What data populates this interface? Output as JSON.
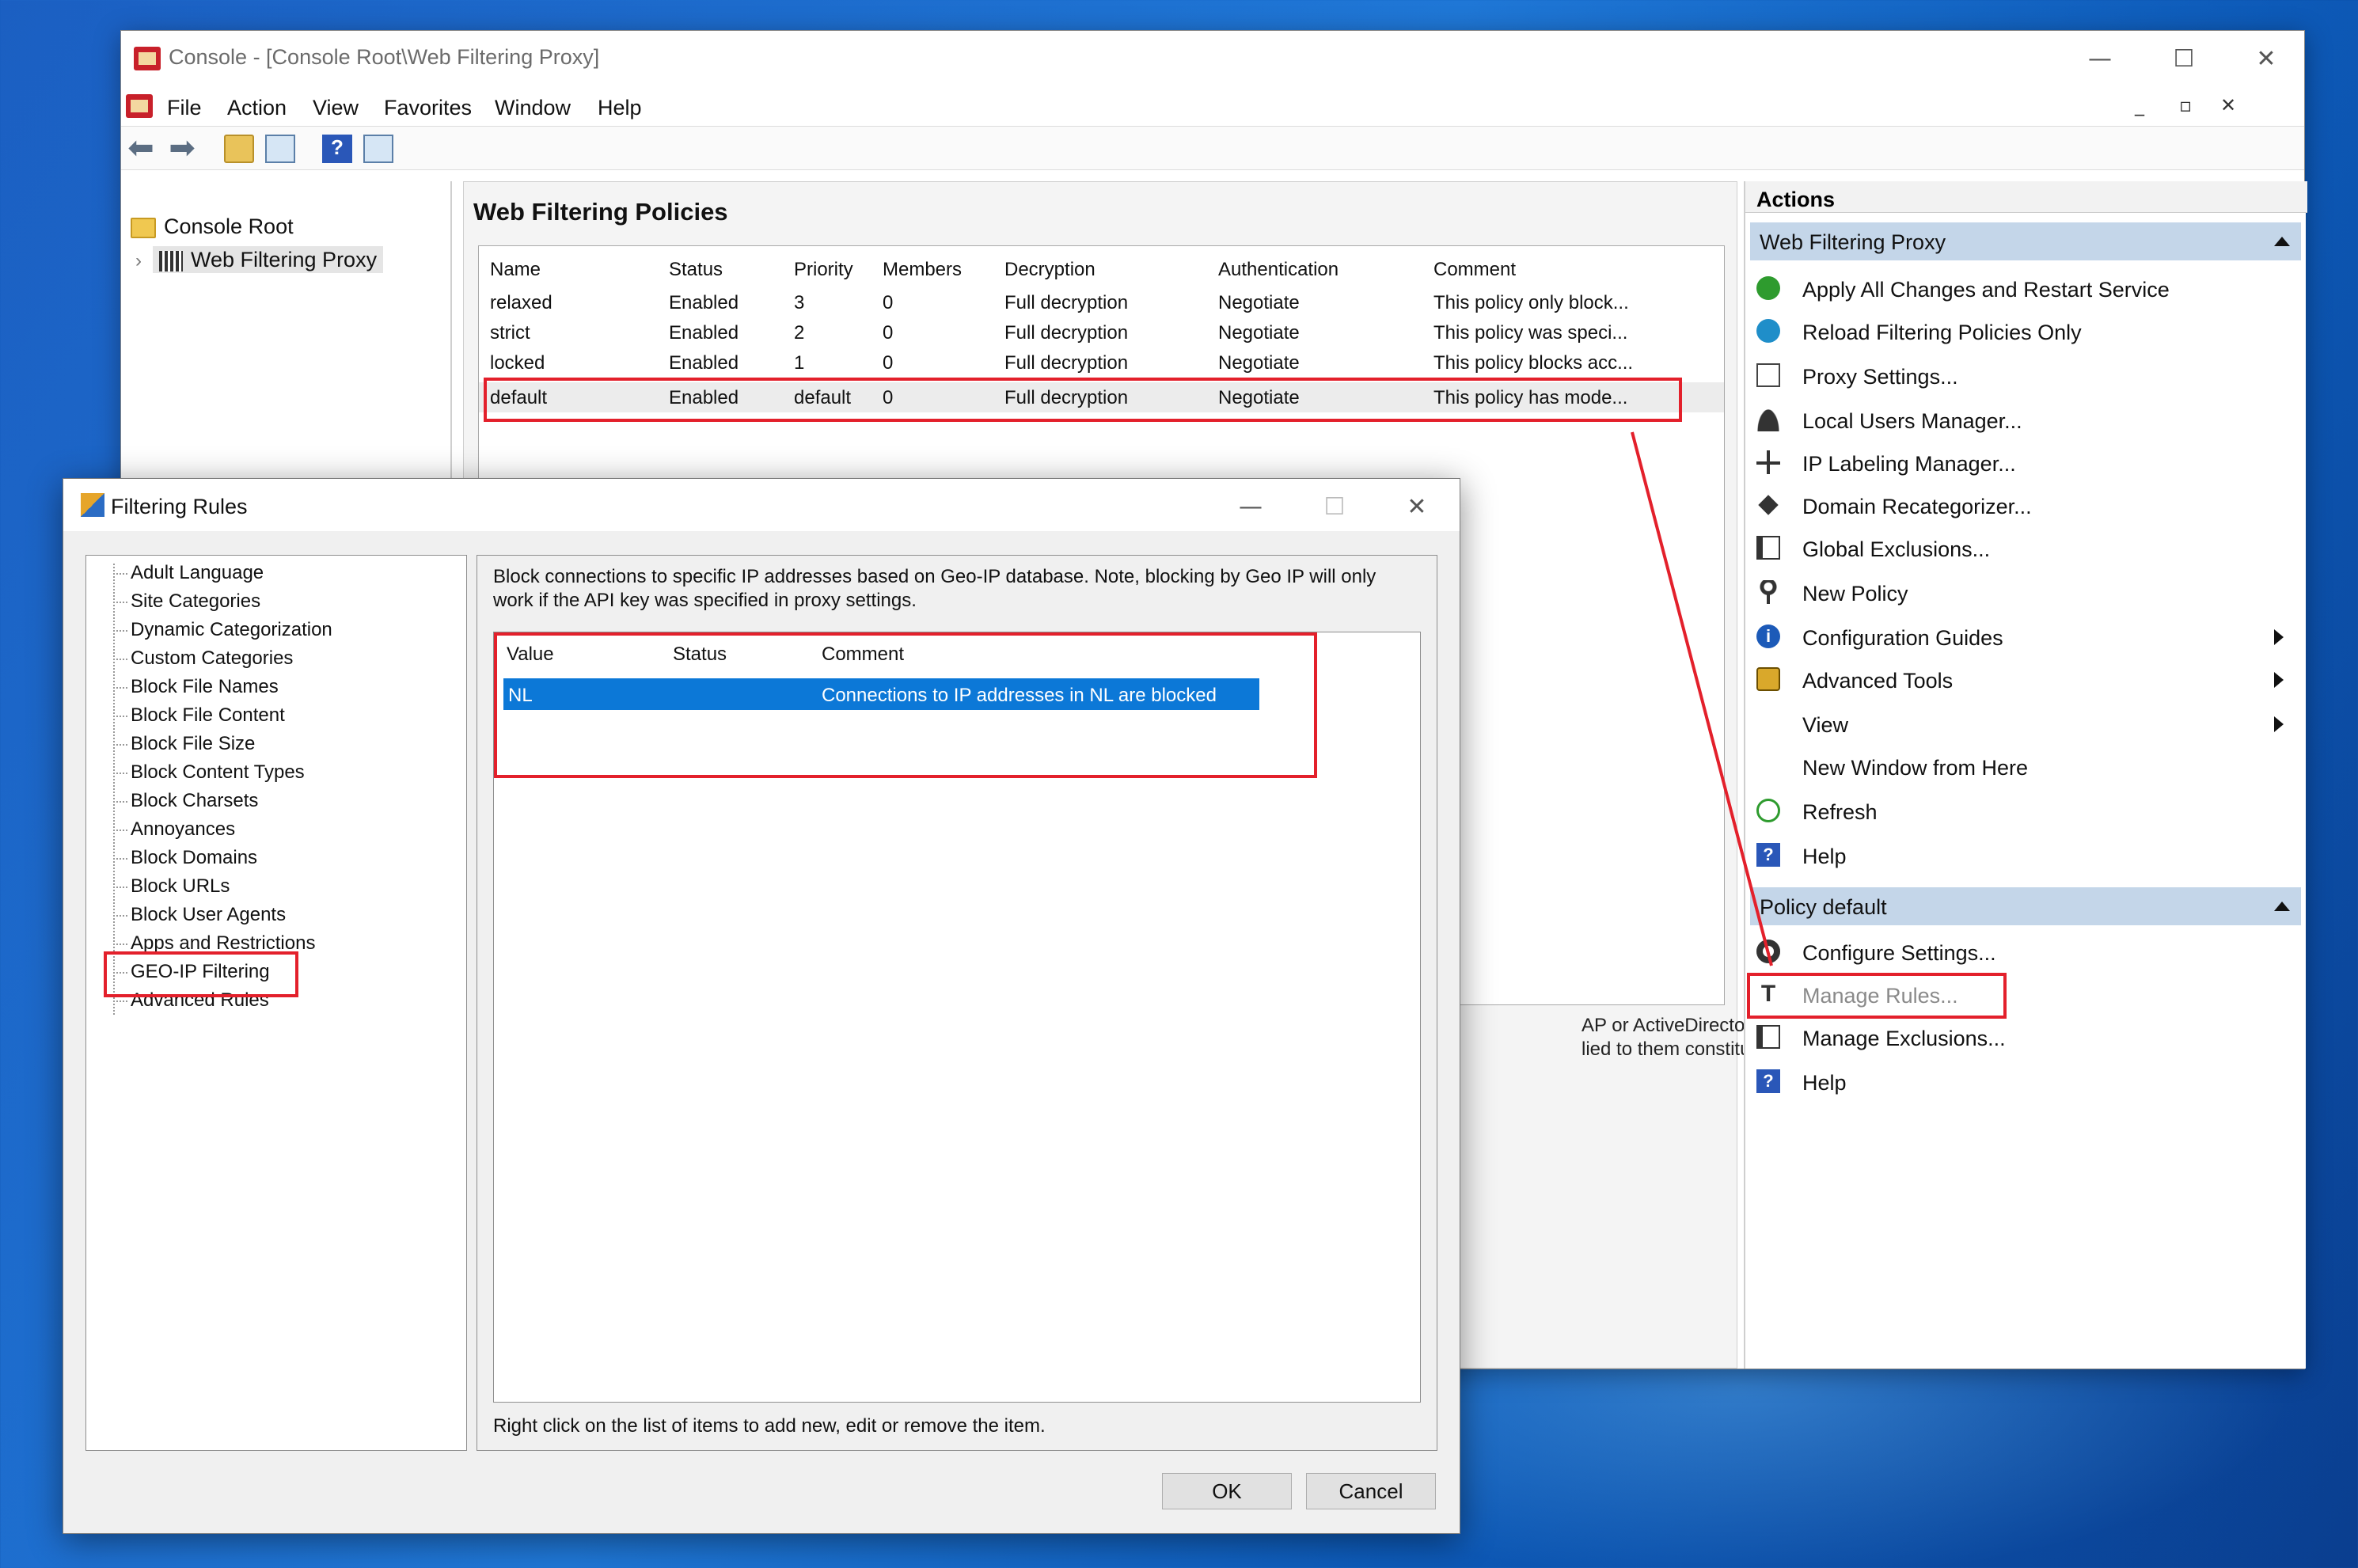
{
  "console": {
    "title": "Console - [Console Root\\Web Filtering Proxy]",
    "controls": {
      "minimize": "—",
      "maximize": "☐",
      "close": "✕"
    },
    "mdi_controls": {
      "minimize": "_",
      "restore": "▫",
      "close": "✕"
    },
    "menu": [
      "File",
      "Action",
      "View",
      "Favorites",
      "Window",
      "Help"
    ],
    "tree": {
      "root": "Console Root",
      "child": "Web Filtering Proxy"
    },
    "center_title": "Web Filtering Policies",
    "columns": [
      "Name",
      "Status",
      "Priority",
      "Members",
      "Decryption",
      "Authentication",
      "Comment"
    ],
    "rows": [
      [
        "relaxed",
        "Enabled",
        "3",
        "0",
        "Full decryption",
        "Negotiate",
        "This policy only block..."
      ],
      [
        "strict",
        "Enabled",
        "2",
        "0",
        "Full decryption",
        "Negotiate",
        "This policy was speci..."
      ],
      [
        "locked",
        "Enabled",
        "1",
        "0",
        "Full decryption",
        "Negotiate",
        "This policy blocks acc..."
      ],
      [
        "default",
        "Enabled",
        "default",
        "0",
        "Full decryption",
        "Negotiate",
        "This policy has mode..."
      ]
    ],
    "partial_text_1": "AP or ActiveDirectory",
    "partial_text_2": "lied to them constitutes a"
  },
  "actions": {
    "header": "Actions",
    "section1": "Web Filtering Proxy",
    "items1": [
      {
        "label": "Apply All Changes and Restart Service",
        "icon": "apply-check-icon"
      },
      {
        "label": "Reload Filtering Policies Only",
        "icon": "reload-check-icon"
      },
      {
        "label": "Proxy Settings...",
        "icon": "proxy-settings-icon"
      },
      {
        "label": "Local Users Manager...",
        "icon": "user-icon"
      },
      {
        "label": "IP Labeling Manager...",
        "icon": "network-icon"
      },
      {
        "label": "Domain Recategorizer...",
        "icon": "pin-icon"
      },
      {
        "label": "Global Exclusions...",
        "icon": "book-icon"
      },
      {
        "label": "New Policy",
        "icon": "key-icon"
      },
      {
        "label": "Configuration Guides",
        "icon": "info-icon"
      },
      {
        "label": "Advanced Tools",
        "icon": "lock-icon"
      },
      {
        "label": "View",
        "icon": ""
      },
      {
        "label": "New Window from Here",
        "icon": ""
      },
      {
        "label": "Refresh",
        "icon": "refresh-icon"
      },
      {
        "label": "Help",
        "icon": "help-icon"
      }
    ],
    "section2": "Policy default",
    "items2": [
      {
        "label": "Configure Settings...",
        "icon": "gear-icon"
      },
      {
        "label": "Manage Rules...",
        "icon": "rules-t-icon"
      },
      {
        "label": "Manage Exclusions...",
        "icon": "exclusions-icon"
      },
      {
        "label": "Help",
        "icon": "help-icon"
      }
    ]
  },
  "dialog": {
    "title": "Filtering Rules",
    "controls": {
      "minimize": "—",
      "maximize": "☐",
      "close": "✕"
    },
    "rules": [
      "Adult Language",
      "Site Categories",
      "Dynamic Categorization",
      "Custom Categories",
      "Block File Names",
      "Block File Content",
      "Block File Size",
      "Block Content Types",
      "Block Charsets",
      "Annoyances",
      "Block Domains",
      "Block URLs",
      "Block User Agents",
      "Apps and Restrictions",
      "GEO-IP Filtering",
      "Advanced Rules"
    ],
    "description": "Block connections to specific IP addresses based on Geo-IP database. Note, blocking by Geo IP will only work if the API key was specified in proxy settings.",
    "list_columns": [
      "Value",
      "Status",
      "Comment"
    ],
    "list_row": {
      "value": "NL",
      "status": "",
      "comment": "Connections to IP addresses in NL are blocked"
    },
    "footer": "Right click on the list of items to add new, edit or remove the item.",
    "ok": "OK",
    "cancel": "Cancel"
  },
  "colors": {
    "accent": "#0c78d7",
    "highlight_box": "#e3202b",
    "action_section": "#c4d6e9"
  }
}
